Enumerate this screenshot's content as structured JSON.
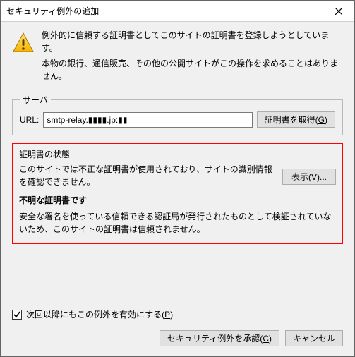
{
  "titlebar": {
    "title": "セキュリティ例外の追加"
  },
  "intro": {
    "line1": "例外的に信頼する証明書としてこのサイトの証明書を登録しようとしています。",
    "line2": "本物の銀行、通信販売、その他の公開サイトがこの操作を求めることはありません。"
  },
  "server": {
    "legend": "サーバ",
    "url_label": "URL:",
    "url_value": "smtp-relay.▮▮▮▮.jp:▮▮",
    "get_cert_prefix": "証明書を取得(",
    "get_cert_accel": "G",
    "get_cert_suffix": ")"
  },
  "status": {
    "title": "証明書の状態",
    "desc": "このサイトでは不正な証明書が使用されており、サイトの識別情報を確認できません。",
    "view_prefix": "表示(",
    "view_accel": "V",
    "view_suffix": ")...",
    "sub": "不明な証明書です",
    "reason": "安全な署名を使っている信頼できる認証局が発行されたものとして検証されていないため、このサイトの証明書は信頼されません。"
  },
  "checkbox": {
    "label_prefix": "次回以降にもこの例外を有効にする(",
    "label_accel": "P",
    "label_suffix": ")",
    "checked": true
  },
  "footer": {
    "confirm_prefix": "セキュリティ例外を承認(",
    "confirm_accel": "C",
    "confirm_suffix": ")",
    "cancel": "キャンセル"
  }
}
